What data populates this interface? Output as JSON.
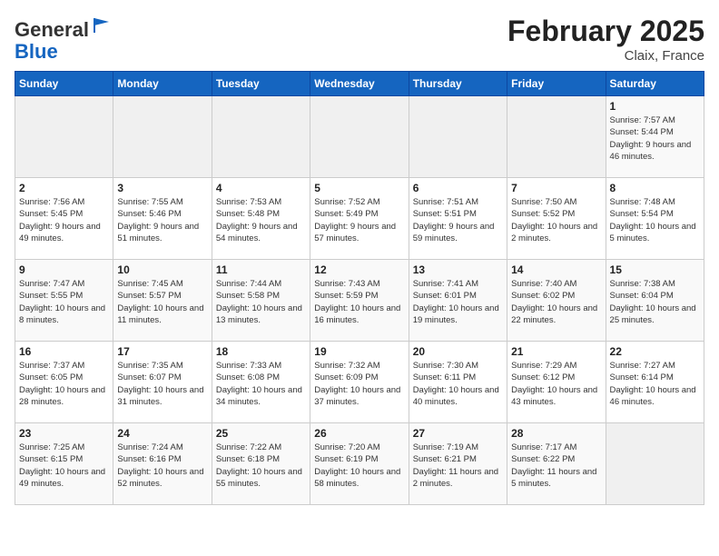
{
  "logo": {
    "general": "General",
    "blue": "Blue"
  },
  "header": {
    "month_year": "February 2025",
    "location": "Claix, France"
  },
  "days_of_week": [
    "Sunday",
    "Monday",
    "Tuesday",
    "Wednesday",
    "Thursday",
    "Friday",
    "Saturday"
  ],
  "weeks": [
    [
      {
        "day": "",
        "info": "",
        "empty": true
      },
      {
        "day": "",
        "info": "",
        "empty": true
      },
      {
        "day": "",
        "info": "",
        "empty": true
      },
      {
        "day": "",
        "info": "",
        "empty": true
      },
      {
        "day": "",
        "info": "",
        "empty": true
      },
      {
        "day": "",
        "info": "",
        "empty": true
      },
      {
        "day": "1",
        "info": "Sunrise: 7:57 AM\nSunset: 5:44 PM\nDaylight: 9 hours and 46 minutes."
      }
    ],
    [
      {
        "day": "2",
        "info": "Sunrise: 7:56 AM\nSunset: 5:45 PM\nDaylight: 9 hours and 49 minutes."
      },
      {
        "day": "3",
        "info": "Sunrise: 7:55 AM\nSunset: 5:46 PM\nDaylight: 9 hours and 51 minutes."
      },
      {
        "day": "4",
        "info": "Sunrise: 7:53 AM\nSunset: 5:48 PM\nDaylight: 9 hours and 54 minutes."
      },
      {
        "day": "5",
        "info": "Sunrise: 7:52 AM\nSunset: 5:49 PM\nDaylight: 9 hours and 57 minutes."
      },
      {
        "day": "6",
        "info": "Sunrise: 7:51 AM\nSunset: 5:51 PM\nDaylight: 9 hours and 59 minutes."
      },
      {
        "day": "7",
        "info": "Sunrise: 7:50 AM\nSunset: 5:52 PM\nDaylight: 10 hours and 2 minutes."
      },
      {
        "day": "8",
        "info": "Sunrise: 7:48 AM\nSunset: 5:54 PM\nDaylight: 10 hours and 5 minutes."
      }
    ],
    [
      {
        "day": "9",
        "info": "Sunrise: 7:47 AM\nSunset: 5:55 PM\nDaylight: 10 hours and 8 minutes."
      },
      {
        "day": "10",
        "info": "Sunrise: 7:45 AM\nSunset: 5:57 PM\nDaylight: 10 hours and 11 minutes."
      },
      {
        "day": "11",
        "info": "Sunrise: 7:44 AM\nSunset: 5:58 PM\nDaylight: 10 hours and 13 minutes."
      },
      {
        "day": "12",
        "info": "Sunrise: 7:43 AM\nSunset: 5:59 PM\nDaylight: 10 hours and 16 minutes."
      },
      {
        "day": "13",
        "info": "Sunrise: 7:41 AM\nSunset: 6:01 PM\nDaylight: 10 hours and 19 minutes."
      },
      {
        "day": "14",
        "info": "Sunrise: 7:40 AM\nSunset: 6:02 PM\nDaylight: 10 hours and 22 minutes."
      },
      {
        "day": "15",
        "info": "Sunrise: 7:38 AM\nSunset: 6:04 PM\nDaylight: 10 hours and 25 minutes."
      }
    ],
    [
      {
        "day": "16",
        "info": "Sunrise: 7:37 AM\nSunset: 6:05 PM\nDaylight: 10 hours and 28 minutes."
      },
      {
        "day": "17",
        "info": "Sunrise: 7:35 AM\nSunset: 6:07 PM\nDaylight: 10 hours and 31 minutes."
      },
      {
        "day": "18",
        "info": "Sunrise: 7:33 AM\nSunset: 6:08 PM\nDaylight: 10 hours and 34 minutes."
      },
      {
        "day": "19",
        "info": "Sunrise: 7:32 AM\nSunset: 6:09 PM\nDaylight: 10 hours and 37 minutes."
      },
      {
        "day": "20",
        "info": "Sunrise: 7:30 AM\nSunset: 6:11 PM\nDaylight: 10 hours and 40 minutes."
      },
      {
        "day": "21",
        "info": "Sunrise: 7:29 AM\nSunset: 6:12 PM\nDaylight: 10 hours and 43 minutes."
      },
      {
        "day": "22",
        "info": "Sunrise: 7:27 AM\nSunset: 6:14 PM\nDaylight: 10 hours and 46 minutes."
      }
    ],
    [
      {
        "day": "23",
        "info": "Sunrise: 7:25 AM\nSunset: 6:15 PM\nDaylight: 10 hours and 49 minutes."
      },
      {
        "day": "24",
        "info": "Sunrise: 7:24 AM\nSunset: 6:16 PM\nDaylight: 10 hours and 52 minutes."
      },
      {
        "day": "25",
        "info": "Sunrise: 7:22 AM\nSunset: 6:18 PM\nDaylight: 10 hours and 55 minutes."
      },
      {
        "day": "26",
        "info": "Sunrise: 7:20 AM\nSunset: 6:19 PM\nDaylight: 10 hours and 58 minutes."
      },
      {
        "day": "27",
        "info": "Sunrise: 7:19 AM\nSunset: 6:21 PM\nDaylight: 11 hours and 2 minutes."
      },
      {
        "day": "28",
        "info": "Sunrise: 7:17 AM\nSunset: 6:22 PM\nDaylight: 11 hours and 5 minutes."
      },
      {
        "day": "",
        "info": "",
        "empty": true
      }
    ]
  ]
}
